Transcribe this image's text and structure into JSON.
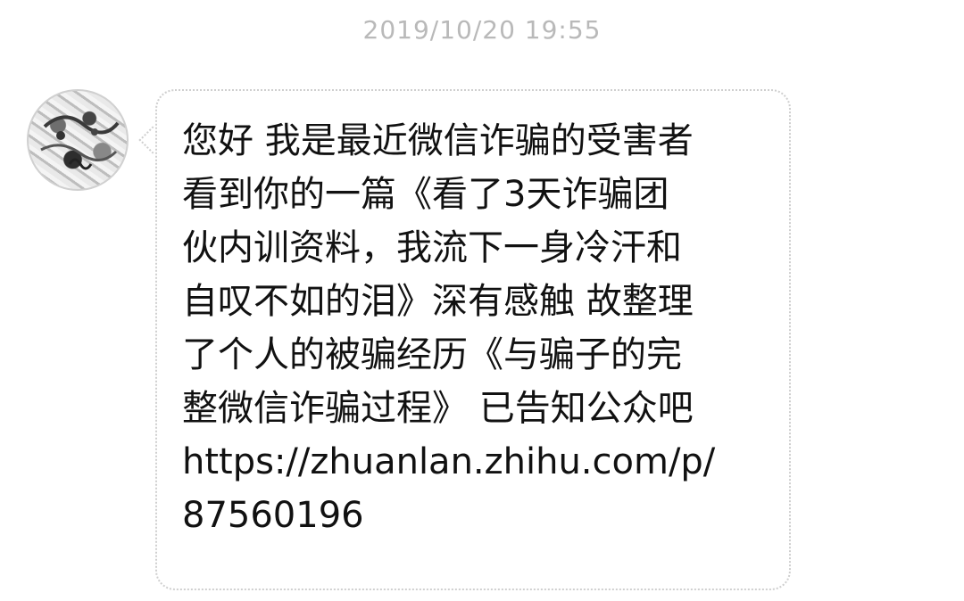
{
  "chat": {
    "timestamp": "2019/10/20 19:55",
    "sender": {
      "avatar_icon": "sender-avatar-icon"
    },
    "message": {
      "text": "您好 我是最近微信诈骗的受害者\n看到你的一篇《看了3天诈骗团\n伙内训资料，我流下一身冷汗和\n自叹不如的泪》深有感触 故整理\n了个人的被骗经历《与骗子的完\n整微信诈骗过程》 已告知公众吧\nhttps://zhuanlan.zhihu.com/p/\n87560196"
    }
  },
  "colors": {
    "background": "#ffffff",
    "timestamp": "#b9b9b9",
    "bubble_border": "#cfcfcf",
    "message_text": "#111111"
  }
}
